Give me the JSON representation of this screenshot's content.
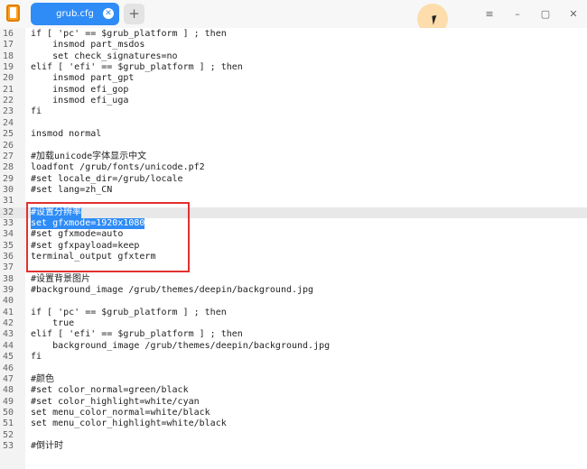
{
  "window": {
    "tab_title": "grub.cfg",
    "tab_close": "✕",
    "add_tab": "+",
    "menu_icon": "≡",
    "minimize": "–",
    "maximize": "▢",
    "close": "✕"
  },
  "editor": {
    "lines": [
      {
        "num": "16",
        "text": "if [ 'pc' == $grub_platform ] ; then"
      },
      {
        "num": "17",
        "text": "    insmod part_msdos"
      },
      {
        "num": "18",
        "text": "    set check_signatures=no"
      },
      {
        "num": "19",
        "text": "elif [ 'efi' == $grub_platform ] ; then"
      },
      {
        "num": "20",
        "text": "    insmod part_gpt"
      },
      {
        "num": "21",
        "text": "    insmod efi_gop"
      },
      {
        "num": "22",
        "text": "    insmod efi_uga"
      },
      {
        "num": "23",
        "text": "fi"
      },
      {
        "num": "24",
        "text": ""
      },
      {
        "num": "25",
        "text": "insmod normal"
      },
      {
        "num": "26",
        "text": ""
      },
      {
        "num": "27",
        "text": "#加载unicode字体显示中文"
      },
      {
        "num": "28",
        "text": "loadfont /grub/fonts/unicode.pf2"
      },
      {
        "num": "29",
        "text": "#set locale_dir=/grub/locale"
      },
      {
        "num": "30",
        "text": "#set lang=zh_CN"
      },
      {
        "num": "31",
        "text": ""
      },
      {
        "num": "32",
        "text": "#设置分辨率"
      },
      {
        "num": "33",
        "text": "set gfxmode=1920x1080"
      },
      {
        "num": "34",
        "text": "#set gfxmode=auto"
      },
      {
        "num": "35",
        "text": "#set gfxpayload=keep"
      },
      {
        "num": "36",
        "text": "terminal_output gfxterm"
      },
      {
        "num": "37",
        "text": ""
      },
      {
        "num": "38",
        "text": "#设置背景图片"
      },
      {
        "num": "39",
        "text": "#background_image /grub/themes/deepin/background.jpg"
      },
      {
        "num": "40",
        "text": ""
      },
      {
        "num": "41",
        "text": "if [ 'pc' == $grub_platform ] ; then"
      },
      {
        "num": "42",
        "text": "    true"
      },
      {
        "num": "43",
        "text": "elif [ 'efi' == $grub_platform ] ; then"
      },
      {
        "num": "44",
        "text": "    background_image /grub/themes/deepin/background.jpg"
      },
      {
        "num": "45",
        "text": "fi"
      },
      {
        "num": "46",
        "text": ""
      },
      {
        "num": "47",
        "text": "#颜色"
      },
      {
        "num": "48",
        "text": "#set color_normal=green/black"
      },
      {
        "num": "49",
        "text": "#set color_highlight=white/cyan"
      },
      {
        "num": "50",
        "text": "set menu_color_normal=white/black"
      },
      {
        "num": "51",
        "text": "set menu_color_highlight=white/black"
      },
      {
        "num": "52",
        "text": ""
      },
      {
        "num": "53",
        "text": "#倒计时"
      }
    ],
    "highlight_color": "#e23030",
    "selection_color": "#2f8cf7",
    "variable_color": "#d33"
  }
}
